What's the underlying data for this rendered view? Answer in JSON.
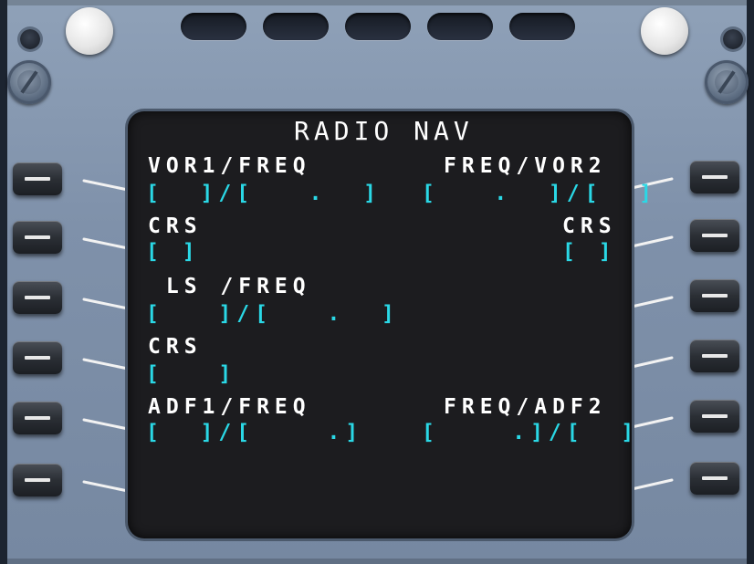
{
  "title": "RADIO NAV",
  "colors": {
    "label": "#ffffff",
    "field": "#2ad8e6",
    "screen": "#1c1c1f",
    "bezel": "#8397b0"
  },
  "rows": {
    "r1_label_left": "VOR1/FREQ",
    "r1_label_right": "FREQ/VOR2",
    "r1_value_left": "[  ]/[   .  ]",
    "r1_value_right": "[   .  ]/[  ]",
    "r2_label_left": "CRS",
    "r2_label_right": "CRS",
    "r2_value_left": "[ ]",
    "r2_value_right": "[ ]",
    "r3_label_left": " LS /FREQ",
    "r3_value_left": "[   ]/[   .  ]",
    "r4_label_left": "CRS",
    "r4_value_left": "[   ]",
    "r5_label_left": "ADF1/FREQ",
    "r5_label_right": "FREQ/ADF2",
    "r5_value_left": "[  ]/[    .]",
    "r5_value_right": "[    .]/[  ]"
  },
  "icons": {
    "line_select_key": "dash-key-icon",
    "knob": "brightness-knob-icon",
    "screw": "screw-icon"
  }
}
